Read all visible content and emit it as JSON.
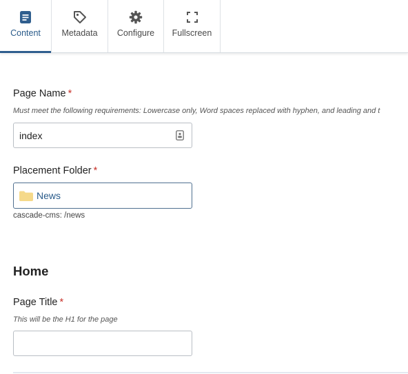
{
  "tabs": [
    {
      "label": "Content",
      "icon": "document-icon",
      "active": true
    },
    {
      "label": "Metadata",
      "icon": "tag-icon",
      "active": false
    },
    {
      "label": "Configure",
      "icon": "gear-icon",
      "active": false
    },
    {
      "label": "Fullscreen",
      "icon": "expand-icon",
      "active": false
    }
  ],
  "page_name": {
    "label": "Page Name",
    "required_mark": "*",
    "help": "Must meet the following requirements: Lowercase only, Word spaces replaced with hyphen, and leading and t",
    "value": "index"
  },
  "placement_folder": {
    "label": "Placement Folder",
    "required_mark": "*",
    "value": "News",
    "path": "cascade-cms: /news"
  },
  "section": {
    "heading": "Home"
  },
  "page_title": {
    "label": "Page Title",
    "required_mark": "*",
    "help": "This will be the H1 for the page",
    "value": ""
  },
  "colors": {
    "accent": "#2f5e8e",
    "required": "#c8322a",
    "folder": "#f5d98a"
  }
}
